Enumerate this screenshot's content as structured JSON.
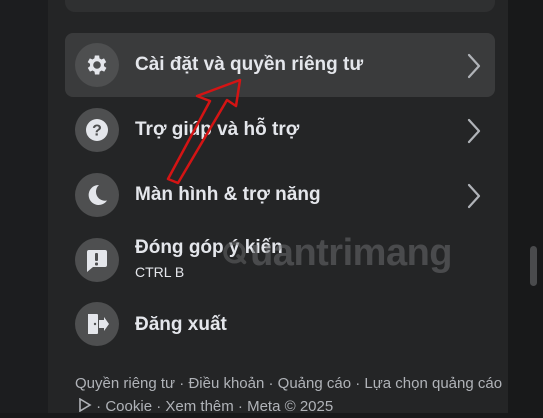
{
  "menu": {
    "items": [
      {
        "label": "Cài đặt và quyền riêng tư",
        "icon": "gear-icon"
      },
      {
        "label": "Trợ giúp và hỗ trợ",
        "icon": "question-icon"
      },
      {
        "label": "Màn hình & trợ năng",
        "icon": "moon-icon"
      },
      {
        "label": "Đóng góp ý kiến",
        "sublabel": "CTRL B",
        "icon": "feedback-icon"
      },
      {
        "label": "Đăng xuất",
        "icon": "logout-icon"
      }
    ]
  },
  "footer": {
    "links": [
      "Quyền riêng tư",
      "Điều khoản",
      "Quảng cáo",
      "Lựa chọn quảng cáo",
      "Cookie",
      "Xem thêm",
      "Meta © 2025"
    ],
    "separator": " · "
  },
  "watermark": {
    "text": "uantrimang"
  },
  "colors": {
    "panel": "#242526",
    "active_item": "#3a3b3c",
    "text": "#e4e6eb",
    "annotation_arrow": "#d41414"
  }
}
